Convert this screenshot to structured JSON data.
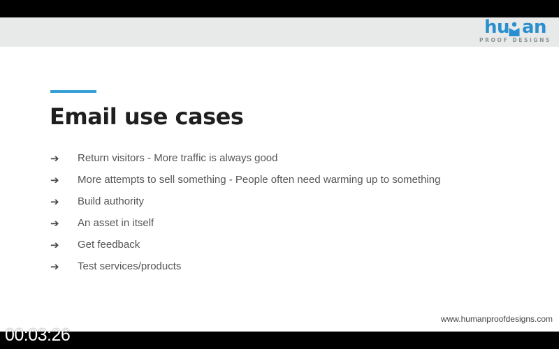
{
  "header": {
    "logo": {
      "word_left": "hu",
      "word_right": "an",
      "icon": "person-m-icon",
      "subtitle": "PROOF DESIGNS",
      "brand_color": "#2a8fd0"
    }
  },
  "slide": {
    "accent_color": "#36a0d6",
    "title": "Email use cases",
    "bullet_icon": "arrow-right-icon",
    "bullets": [
      {
        "arrow": "➔",
        "text": "Return visitors - More traffic is always good"
      },
      {
        "arrow": "➔",
        "text": "More attempts to sell something - People often need warming up to something"
      },
      {
        "arrow": "➔",
        "text": "Build authority"
      },
      {
        "arrow": "➔",
        "text": "An asset in itself"
      },
      {
        "arrow": "➔",
        "text": "Get feedback"
      },
      {
        "arrow": "➔",
        "text": "Test services/products"
      }
    ],
    "footer_url": "www.humanproofdesigns.com"
  },
  "video": {
    "timestamp": "00:03:26"
  }
}
